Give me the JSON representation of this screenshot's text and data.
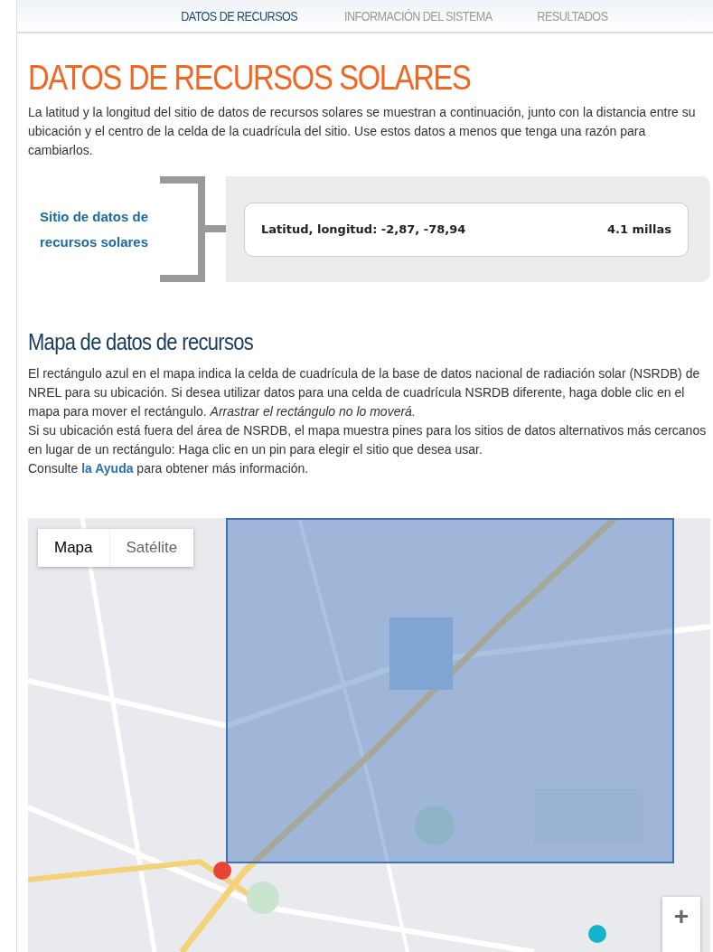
{
  "nav": {
    "tabs": [
      {
        "label": "DATOS DE RECURSOS",
        "selected": true
      },
      {
        "label": "INFORMACIÓN DEL SISTEMA",
        "selected": false
      },
      {
        "label": "RESULTADOS",
        "selected": false
      }
    ]
  },
  "title": "DATOS DE RECURSOS SOLARES",
  "intro": "La latitud y la longitud del sitio de datos de recursos solares se muestran a continuación, junto con la distancia entre su ubicación y el centro de la celda de la cuadrícula del sitio. Use estos datos a menos que tenga una razón para cambiarlos.",
  "site": {
    "label": "Sitio de datos de recursos solares",
    "coordinates": "Latitud, longitud: -2,87, -78,94",
    "distance": "4.1 millas"
  },
  "map_section": {
    "heading": "Mapa de datos de recursos",
    "paragraphs": [
      "El rectángulo azul en el mapa indica la celda de cuadrícula de la base de datos nacional de radiación solar (NSRDB) de NREL para su ubicación. Si desea utilizar datos para una celda de cuadrícula NSRDB diferente, haga doble clic en el mapa para mover el rectángulo. *Arrastrar el rectángulo no lo moverá.*",
      "Si su ubicación está fuera del área de NSRDB, el mapa muestra pines para los sitios de datos alternativos más cercanos en lugar de un rectángulo: Haga clic en un pin para elegir el sitio que desea usar."
    ],
    "help": {
      "before": "Consulte ",
      "link": "la Ayuda",
      "after": " para obtener más información."
    }
  },
  "map": {
    "kind": "picture",
    "map_types": [
      {
        "label": "Mapa",
        "selected": true
      },
      {
        "label": "Satélite",
        "selected": false
      }
    ],
    "zoom_in": "+"
  }
}
